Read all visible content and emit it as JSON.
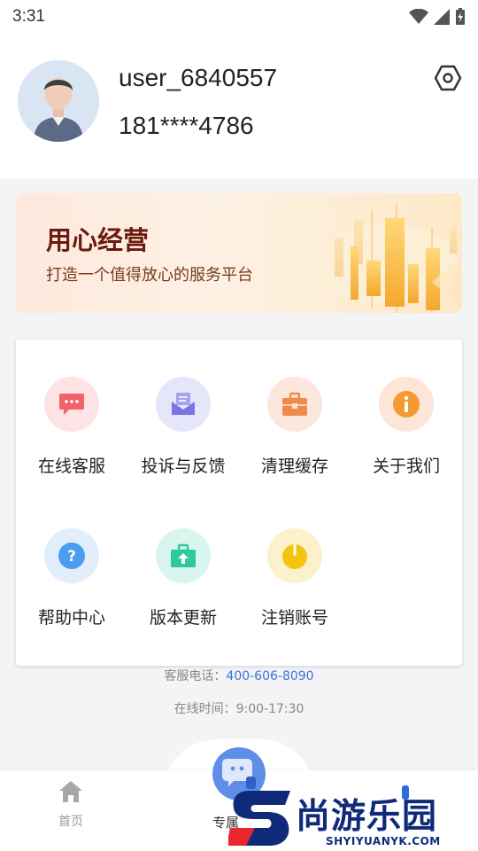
{
  "status_bar": {
    "time": "3:31"
  },
  "profile": {
    "username": "user_6840557",
    "phone": "181****4786"
  },
  "banner": {
    "title": "用心经营",
    "subtitle": "打造一个值得放心的服务平台"
  },
  "services": [
    {
      "label": "在线客服",
      "icon": "chat-bubble-icon",
      "bg": "#fde3e3",
      "fg": "#f0636b"
    },
    {
      "label": "投诉与反馈",
      "icon": "mail-icon",
      "bg": "#e6e6fb",
      "fg": "#7b74e6"
    },
    {
      "label": "清理缓存",
      "icon": "toolbox-icon",
      "bg": "#fde6dc",
      "fg": "#f08a4b"
    },
    {
      "label": "关于我们",
      "icon": "info-icon",
      "bg": "#fde6d7",
      "fg": "#f39b32"
    },
    {
      "label": "帮助中心",
      "icon": "help-icon",
      "bg": "#e2eefc",
      "fg": "#4a9df0"
    },
    {
      "label": "版本更新",
      "icon": "update-icon",
      "bg": "#d9f6ee",
      "fg": "#2fc9a0"
    },
    {
      "label": "注销账号",
      "icon": "power-icon",
      "bg": "#fdf1cc",
      "fg": "#f5c50e"
    }
  ],
  "contact": {
    "phone_label": "客服电话：",
    "phone": "400-606-8090",
    "hours": "在线时间：9:00-17:30"
  },
  "tabbar": {
    "home": "首页",
    "center": "专属"
  },
  "watermark": {
    "text": "尚游乐园",
    "url": "SHYIYUANYK.COM"
  }
}
